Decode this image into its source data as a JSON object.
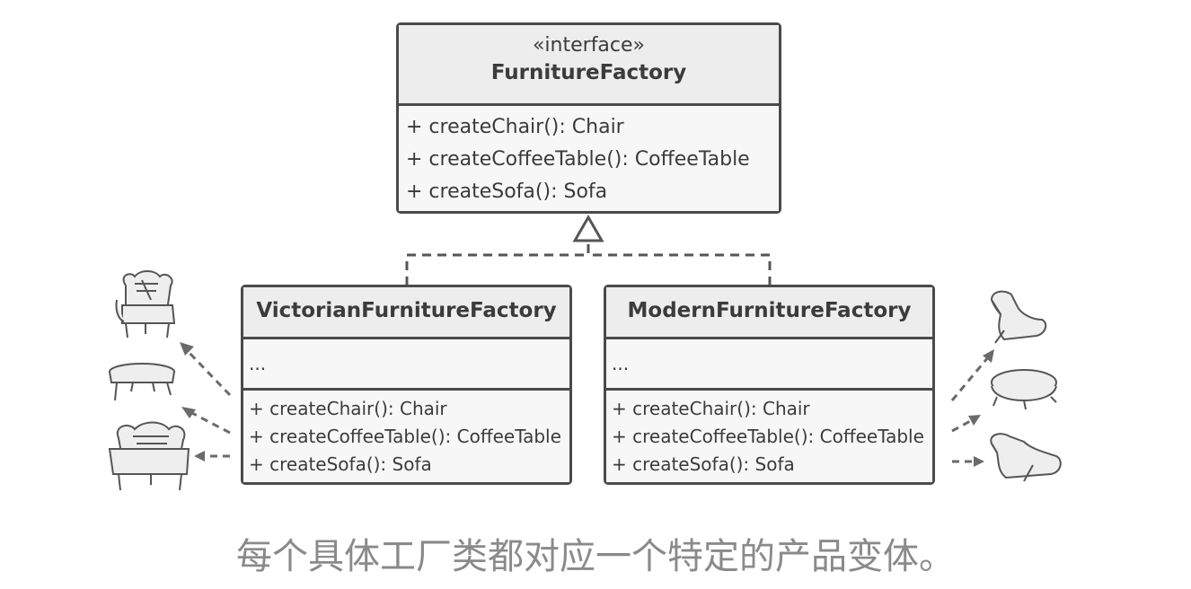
{
  "interface_box": {
    "stereotype": "«interface»",
    "name": "FurnitureFactory",
    "methods": [
      "+ createChair(): Chair",
      "+ createCoffeeTable(): CoffeeTable",
      "+ createSofa(): Sofa"
    ]
  },
  "victorian_box": {
    "name": "VictorianFurnitureFactory",
    "fields": "...",
    "methods": [
      "+ createChair(): Chair",
      "+ createCoffeeTable(): CoffeeTable",
      "+ createSofa(): Sofa"
    ]
  },
  "modern_box": {
    "name": "ModernFurnitureFactory",
    "fields": "...",
    "methods": [
      "+ createChair(): Chair",
      "+ createCoffeeTable(): CoffeeTable",
      "+ createSofa(): Sofa"
    ]
  },
  "icons": {
    "victorian": [
      "victorian-chair-icon",
      "victorian-coffee-table-icon",
      "victorian-sofa-icon"
    ],
    "modern": [
      "modern-chair-icon",
      "modern-coffee-table-icon",
      "modern-sofa-icon"
    ]
  },
  "caption": "每个具体工厂类都对应一个特定的产品变体。",
  "colors": {
    "box_fill": "#ededed",
    "stroke": "#4a4a4a",
    "arrow": "#666666",
    "caption": "#8a8a8a"
  }
}
